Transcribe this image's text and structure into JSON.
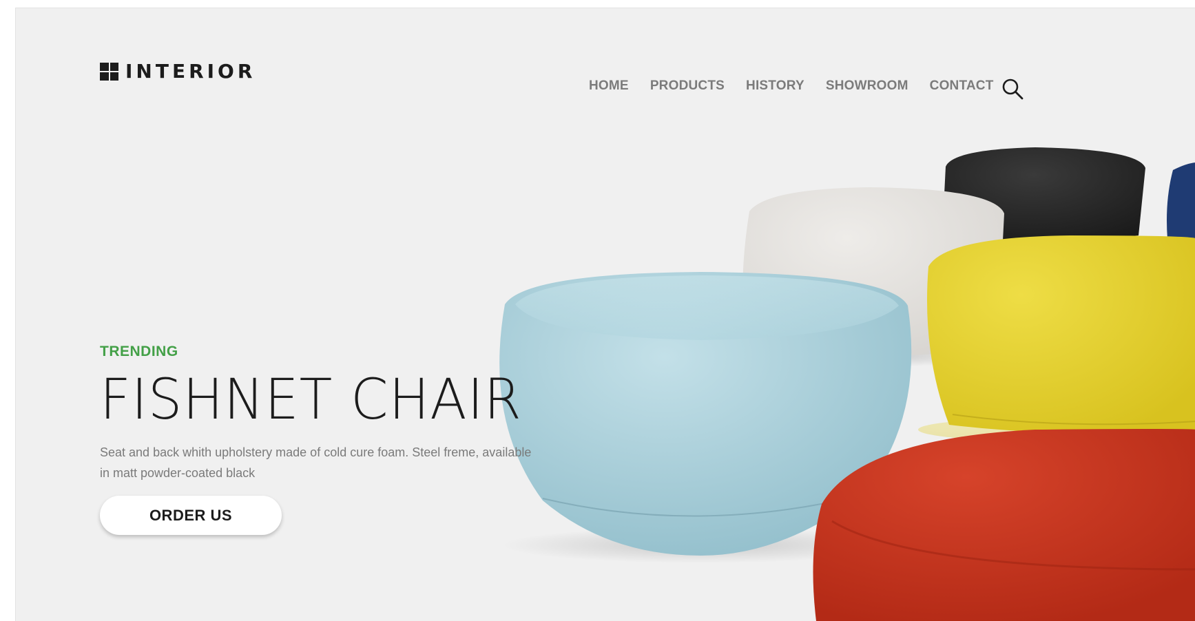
{
  "brand": {
    "name": "INTERIOR"
  },
  "nav": {
    "items": [
      "HOME",
      "PRODUCTS",
      "HISTORY",
      "SHOWROOM",
      "CONTACT"
    ]
  },
  "hero": {
    "tag": "TRENDING",
    "title": "FISHNET CHAIR",
    "description": "Seat and back whith upholstery made of cold cure foam. Steel freme, available in matt powder-coated black",
    "cta": "ORDER US"
  },
  "icons": {
    "search": "search-icon",
    "logo": "grid-logo-icon"
  },
  "colors": {
    "accent": "#43a047",
    "background": "#f0f0f0",
    "text": "#1c1c1c",
    "nav": "#7b7b7b",
    "poufs": [
      "#a9cfd9",
      "#e3e1dd",
      "#262626",
      "#e6d22e",
      "#c8321d",
      "#1f3b73"
    ]
  }
}
